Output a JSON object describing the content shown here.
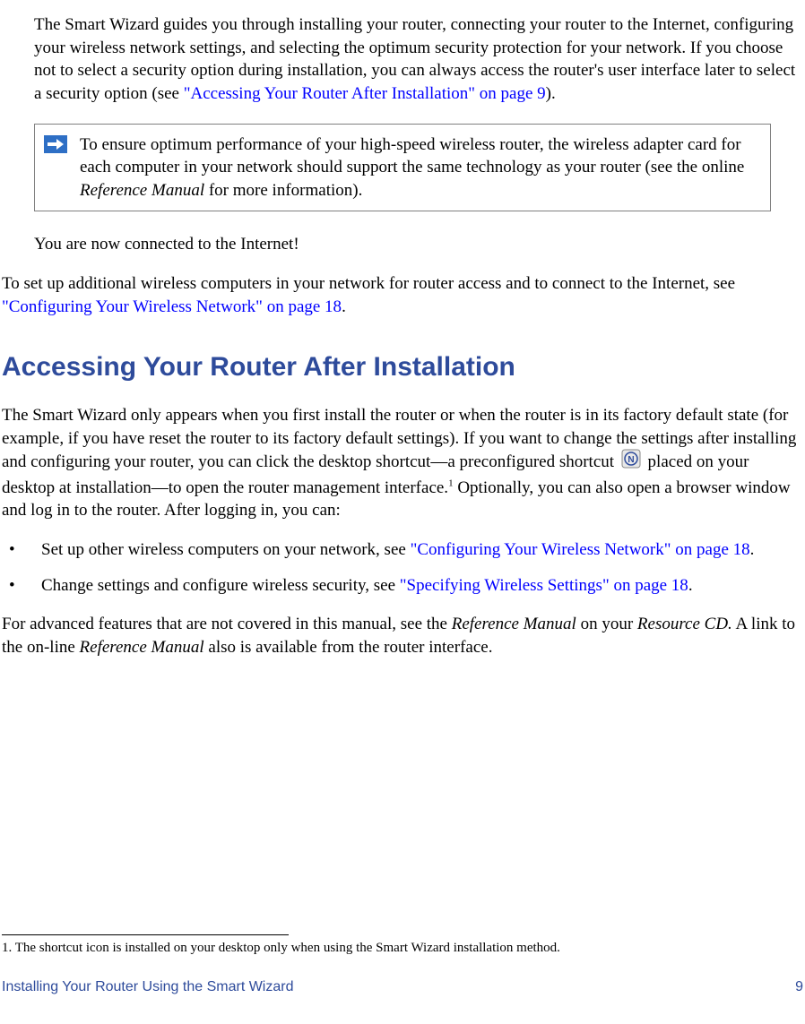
{
  "para1_part1": "The Smart Wizard guides you through installing your router, connecting your router to the Internet, configuring your wireless network settings, and selecting the optimum security protection for your network. If you choose not to select a security option during installation, you can always access the router's user interface later to select a security option (see ",
  "para1_link": "\"Accessing Your Router After Installation\" on page 9",
  "para1_part2": ").",
  "note_text_part1": "To ensure optimum performance of your high-speed wireless router, the wireless adapter card for each computer in your network should support the same technology as your router (see the online ",
  "note_text_italic": "Reference Manual",
  "note_text_part2": " for more information).",
  "para2": "You are now connected to the Internet!",
  "para3_part1": "To set up additional wireless computers in your network for router access and to connect to the Internet, see ",
  "para3_link": "\"Configuring Your Wireless Network\" on page 18",
  "para3_part2": ".",
  "heading": "Accessing Your Router After Installation",
  "para4_part1": "The Smart Wizard only appears when you first install the router or when the router is in its factory default state (for example, if you have reset the router to its factory default settings). If you want to change the settings after installing and configuring your router, you can click the desktop shortcut—a preconfigured shortcut ",
  "para4_part2": " placed on your desktop at installation—to open the router management interface.",
  "para4_sup": "1",
  "para4_part3": " Optionally, you can also open a browser window and log in to the router. After logging in, you can:",
  "bullet1_part1": "Set up other wireless computers on your network, see ",
  "bullet1_link": "\"Configuring Your Wireless Network\" on page 18",
  "bullet1_part2": ".",
  "bullet2_part1": "Change settings and configure wireless security, see ",
  "bullet2_link": "\"Specifying Wireless Settings\" on page 18",
  "bullet2_part2": ".",
  "para5_part1": "For advanced features that are not covered in this manual, see the ",
  "para5_italic1": "Reference Manual",
  "para5_part2": " on your ",
  "para5_italic2": "Resource CD.",
  "para5_part3": " A link to the on-line ",
  "para5_italic3": "Reference Manual",
  "para5_part4": " also is available from the router interface.",
  "footnote": "1. The shortcut icon is installed on your desktop only when using the Smart Wizard installation method.",
  "footer_left": "Installing Your Router Using the Smart Wizard",
  "footer_right": "9",
  "bullet_symbol": "•"
}
